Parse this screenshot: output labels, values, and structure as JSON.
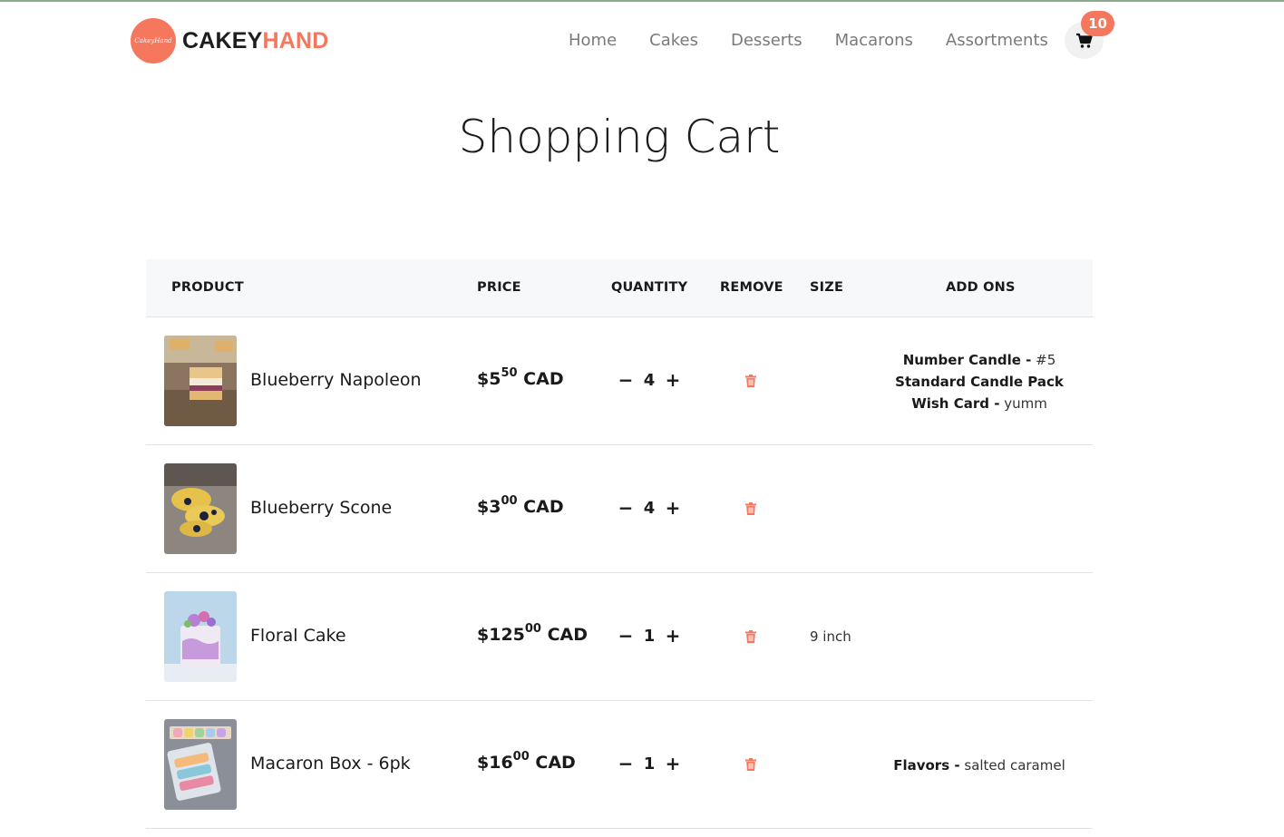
{
  "header": {
    "logo_text": "CakeyHand",
    "brand_part1": "CAKEY",
    "brand_part2": "HAND",
    "nav": [
      "Home",
      "Cakes",
      "Desserts",
      "Macarons",
      "Assortments"
    ],
    "cart_count": "10"
  },
  "page_title": "Shopping Cart",
  "columns": {
    "product": "PRODUCT",
    "price": "PRICE",
    "quantity": "QUANTITY",
    "remove": "REMOVE",
    "size": "SIZE",
    "addons": "ADD ONS"
  },
  "qty_controls": {
    "minus": "−",
    "plus": "+"
  },
  "items": [
    {
      "name": "Blueberry Napoleon",
      "price_dollars": "$5",
      "price_cents": "50",
      "currency": "CAD",
      "quantity": "4",
      "size": "",
      "addons": [
        {
          "label": "Number Candle -",
          "value": "#5"
        },
        {
          "label": "Standard Candle Pack",
          "value": ""
        },
        {
          "label": "Wish Card -",
          "value": "yumm"
        }
      ]
    },
    {
      "name": "Blueberry Scone",
      "price_dollars": "$3",
      "price_cents": "00",
      "currency": "CAD",
      "quantity": "4",
      "size": "",
      "addons": []
    },
    {
      "name": "Floral Cake",
      "price_dollars": "$125",
      "price_cents": "00",
      "currency": "CAD",
      "quantity": "1",
      "size": "9 inch",
      "addons": []
    },
    {
      "name": "Macaron Box - 6pk",
      "price_dollars": "$16",
      "price_cents": "00",
      "currency": "CAD",
      "quantity": "1",
      "size": "",
      "addons": [
        {
          "label": "Flavors -",
          "value": "salted caramel"
        }
      ]
    }
  ],
  "colors": {
    "accent": "#f4775e",
    "header_bg": "#f7f8f9"
  }
}
